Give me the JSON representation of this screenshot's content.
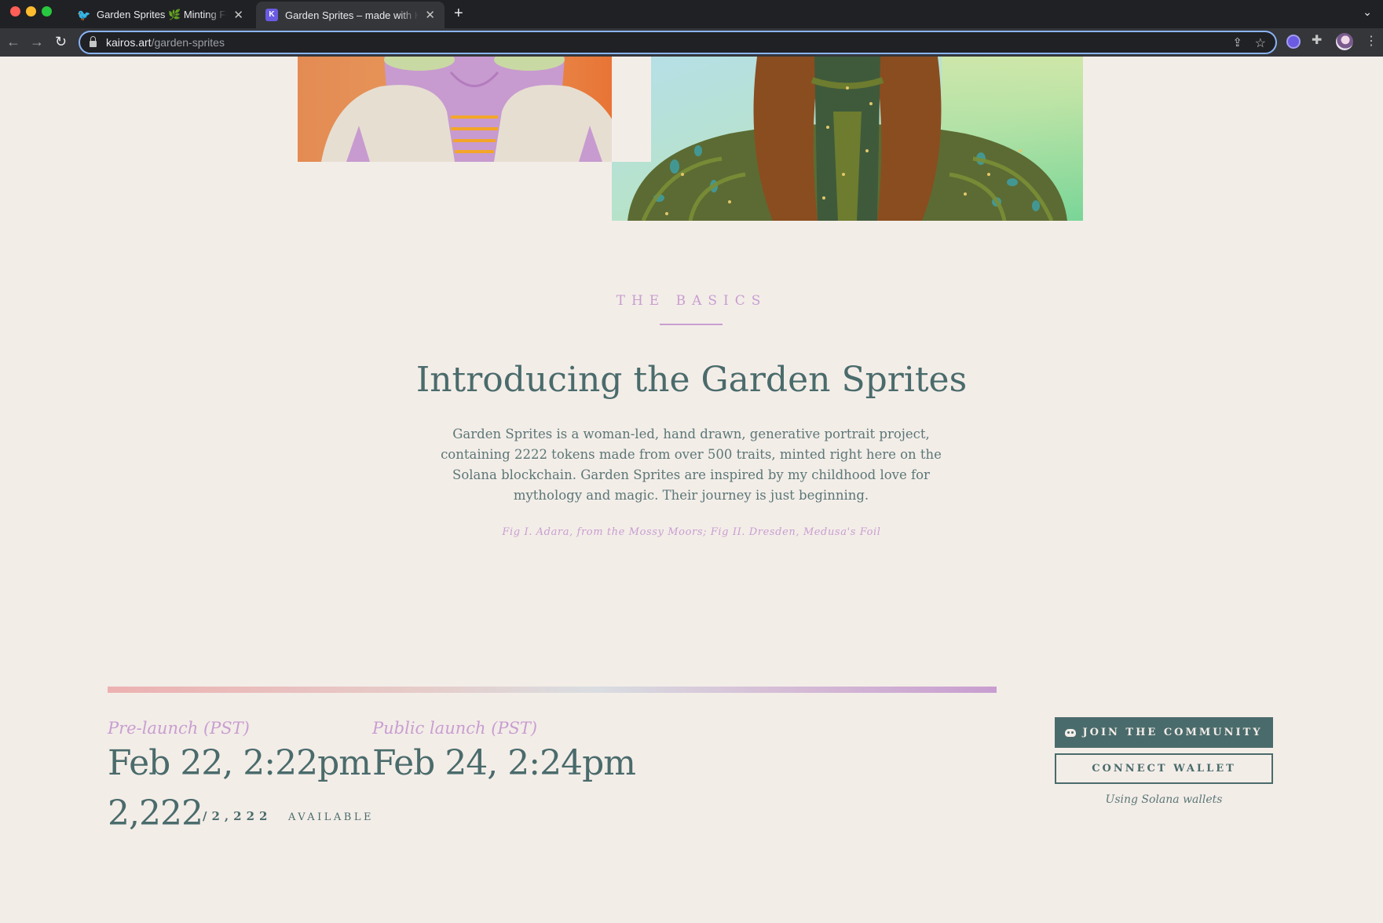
{
  "browser": {
    "tabs": [
      {
        "title": "Garden Sprites 🌿 Minting Feb",
        "icon": "twitter-bird-icon",
        "active": false
      },
      {
        "title": "Garden Sprites – made with Ka",
        "icon": "kairos-logo-icon",
        "active": true
      }
    ],
    "new_tab": "+",
    "tab_menu": "⌄",
    "url_host": "kairos.art",
    "url_path": "/garden-sprites",
    "nav": {
      "back": "←",
      "forward": "→",
      "reload": "↻"
    },
    "menu": "⋮"
  },
  "basics": {
    "eyebrow": "THE BASICS",
    "headline": "Introducing the Garden Sprites",
    "body": "Garden Sprites is a woman-led, hand drawn, generative portrait project, containing 2222 tokens made from over 500 traits, minted right here on the Solana blockchain. Garden Sprites are inspired by my childhood love for mythology and magic. Their journey is just beginning.",
    "caption": "Fig I. Adara, from the Mossy Moors; Fig II. Dresden, Medusa's Foil"
  },
  "launch": {
    "prelaunch_label": "Pre-launch (PST)",
    "prelaunch_date": "Feb 22, 2:22pm",
    "public_label": "Public launch (PST)",
    "public_date": "Feb 24, 2:24pm"
  },
  "availability": {
    "count": "2,222",
    "total": "/2,222",
    "label": "AVAILABLE"
  },
  "actions": {
    "join_label": "JOIN THE COMMUNITY",
    "connect_label": "CONNECT WALLET",
    "wallet_note": "Using Solana wallets"
  },
  "colors": {
    "background": "#f3ede8",
    "primary": "#4a6b6b",
    "accent": "#c89ed0"
  }
}
